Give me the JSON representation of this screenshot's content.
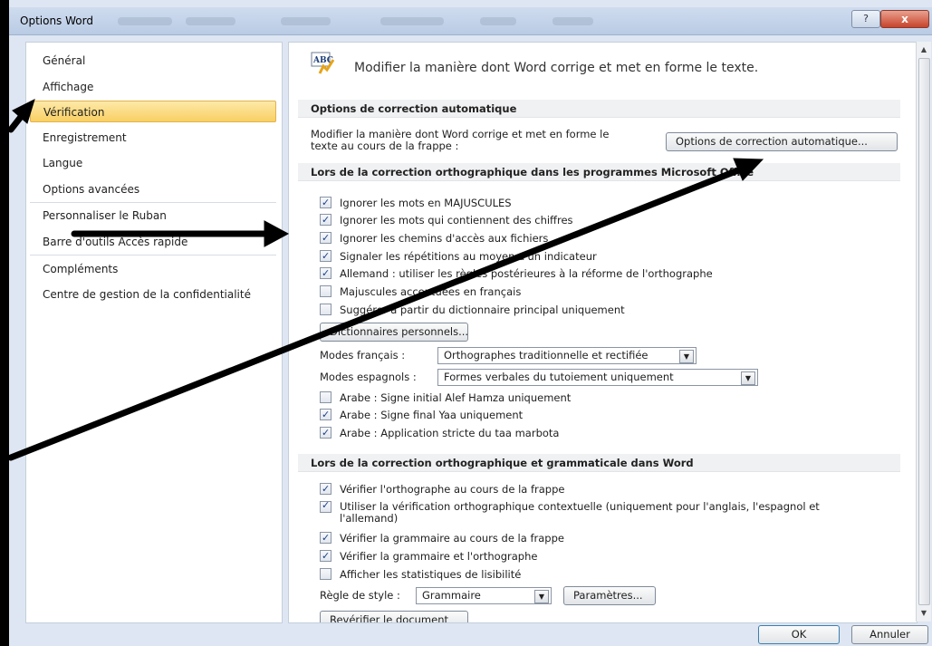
{
  "window": {
    "title": "Options Word",
    "help_label": "?",
    "close_label": "x"
  },
  "sidebar": {
    "items": [
      {
        "label": "Général"
      },
      {
        "label": "Affichage"
      },
      {
        "label": "Vérification",
        "active": true
      },
      {
        "label": "Enregistrement"
      },
      {
        "label": "Langue"
      },
      {
        "label": "Options avancées"
      },
      {
        "label": "Personnaliser le Ruban"
      },
      {
        "label": "Barre d'outils Accès rapide"
      },
      {
        "label": "Compléments"
      },
      {
        "label": "Centre de gestion de la confidentialité"
      }
    ]
  },
  "main": {
    "header_icon": "abc-check-icon",
    "header_text": "Modifier la manière dont Word corrige et met en forme le texte.",
    "autocorrect": {
      "heading": "Options de correction automatique",
      "description_line1": "Modifier la manière dont Word corrige et met en forme le",
      "description_line2": "texte au cours de la frappe :",
      "button": "Options de correction automatique..."
    },
    "office_spelling": {
      "heading": "Lors de la correction orthographique dans les programmes Microsoft Office",
      "checkboxes": [
        {
          "label": "Ignorer les mots en MAJUSCULES",
          "checked": true
        },
        {
          "label": "Ignorer les mots qui contiennent des chiffres",
          "checked": true
        },
        {
          "label": "Ignorer les chemins d'accès aux fichiers",
          "checked": true
        },
        {
          "label": "Signaler les répétitions au moyen d'un indicateur",
          "checked": true
        },
        {
          "label": "Allemand : utiliser les règles postérieures à la réforme de l'orthographe",
          "checked": true
        },
        {
          "label": "Majuscules accentuées en français",
          "checked": false
        },
        {
          "label": "Suggérer à partir du dictionnaire principal uniquement",
          "checked": false
        }
      ],
      "dictionaries_button": "Dictionnaires personnels...",
      "french_modes_label": "Modes français :",
      "french_modes_value": "Orthographes traditionnelle et rectifiée",
      "spanish_modes_label": "Modes espagnols :",
      "spanish_modes_value": "Formes verbales du tutoiement uniquement",
      "arabic_checkboxes": [
        {
          "label": "Arabe : Signe initial Alef Hamza uniquement",
          "checked": false
        },
        {
          "label": "Arabe : Signe final Yaa uniquement",
          "checked": true
        },
        {
          "label": "Arabe : Application stricte du taa marbota",
          "checked": true
        }
      ]
    },
    "word_spelling": {
      "heading": "Lors de la correction orthographique et grammaticale dans Word",
      "checkboxes": [
        {
          "label": "Vérifier l'orthographe au cours de la frappe",
          "checked": true
        },
        {
          "label": "Utiliser la vérification orthographique contextuelle (uniquement pour l'anglais, l'espagnol et",
          "label2": "l'allemand)",
          "checked": true
        },
        {
          "label": "Vérifier la grammaire au cours de la frappe",
          "checked": true
        },
        {
          "label": "Vérifier la grammaire et l'orthographe",
          "checked": true
        },
        {
          "label": "Afficher les statistiques de lisibilité",
          "checked": false
        }
      ],
      "style_rule_label": "Règle de style :",
      "style_rule_value": "Grammaire",
      "settings_button": "Paramètres...",
      "recheck_button": "Revérifier le document"
    }
  },
  "footer": {
    "ok_label": "OK",
    "cancel_label": "Annuler"
  }
}
